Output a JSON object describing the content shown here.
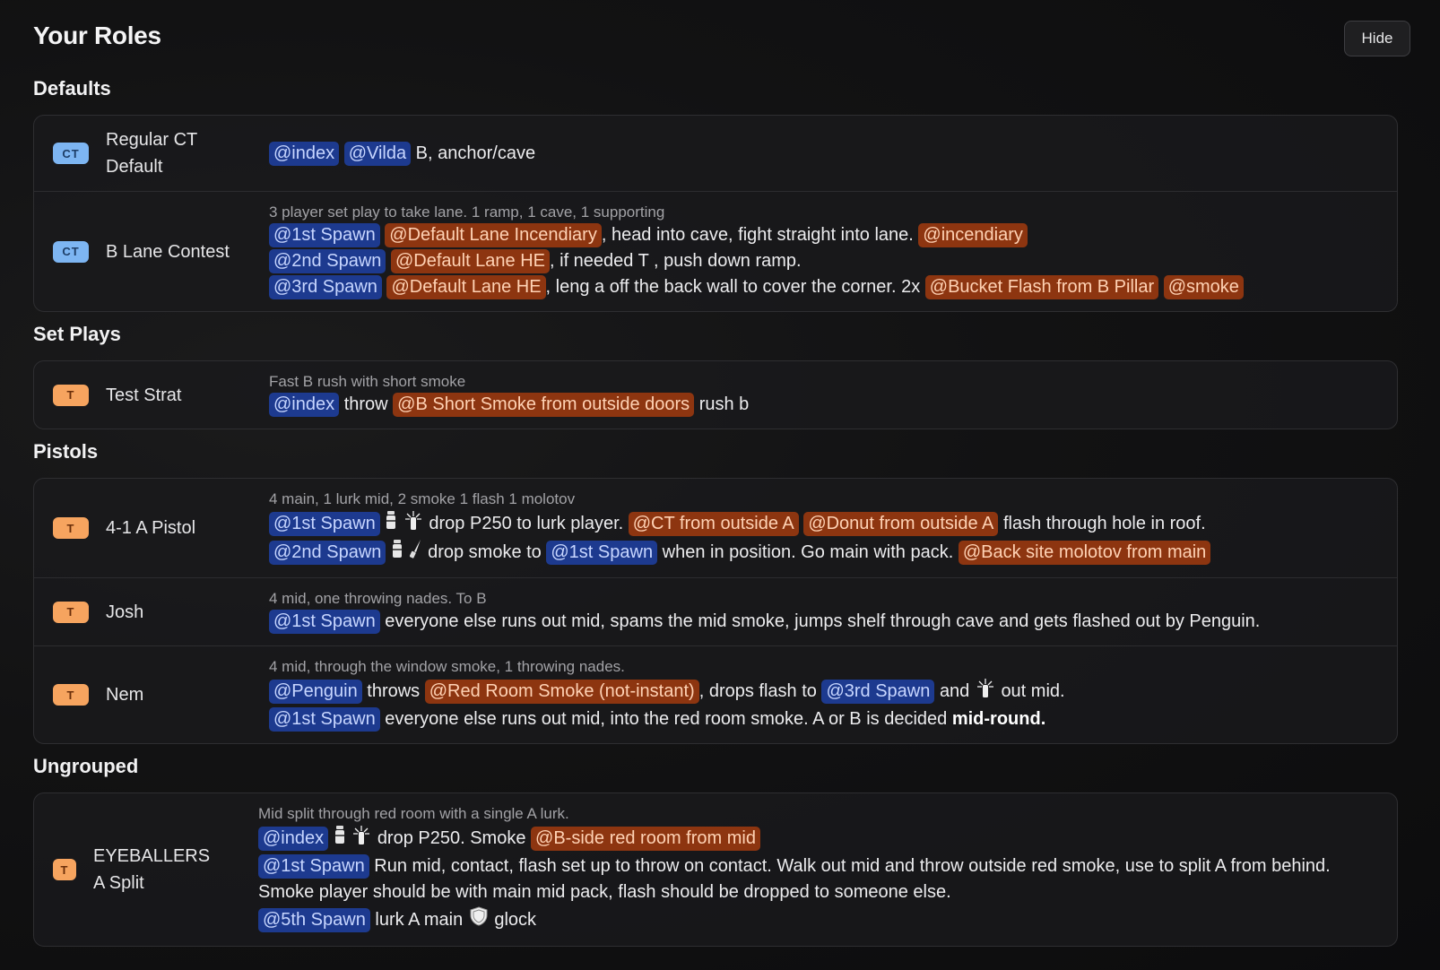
{
  "page": {
    "title": "Your Roles",
    "hide_label": "Hide"
  },
  "groups": [
    {
      "title": "Defaults",
      "rows": [
        {
          "side": "CT",
          "name": "Regular CT Default",
          "desc": "",
          "lines": [
            [
              {
                "t": "player",
                "v": "@index"
              },
              {
                "t": "player",
                "v": "@Vilda"
              },
              {
                "t": "text",
                "v": "B, anchor/cave"
              }
            ]
          ]
        },
        {
          "side": "CT",
          "name": "B Lane Contest",
          "desc": "3 player set play to take lane. 1 ramp, 1 cave, 1 supporting",
          "lines": [
            [
              {
                "t": "player",
                "v": "@1st Spawn"
              },
              {
                "t": "nade",
                "v": "@Default Lane Incendiary"
              },
              {
                "t": "text",
                "v": ", head into cave, fight straight into lane."
              },
              {
                "t": "nade",
                "v": "@incendiary"
              }
            ],
            [
              {
                "t": "player",
                "v": "@2nd Spawn"
              },
              {
                "t": "nade",
                "v": "@Default Lane HE"
              },
              {
                "t": "text",
                "v": ", if needed T , push down ramp."
              }
            ],
            [
              {
                "t": "player",
                "v": "@3rd Spawn"
              },
              {
                "t": "nade",
                "v": "@Default Lane HE"
              },
              {
                "t": "text",
                "v": ", leng a off the back wall to cover the corner. 2x"
              },
              {
                "t": "nade",
                "v": "@Bucket Flash from B Pillar"
              },
              {
                "t": "nade",
                "v": "@smoke"
              }
            ]
          ]
        }
      ]
    },
    {
      "title": "Set Plays",
      "rows": [
        {
          "side": "T",
          "name": "Test Strat",
          "desc": "Fast B rush with short smoke",
          "lines": [
            [
              {
                "t": "player",
                "v": "@index"
              },
              {
                "t": "text",
                "v": "throw"
              },
              {
                "t": "nade",
                "v": "@B Short Smoke from outside doors"
              },
              {
                "t": "text",
                "v": "rush b"
              }
            ]
          ]
        }
      ]
    },
    {
      "title": "Pistols",
      "rows": [
        {
          "side": "T",
          "name": "4-1 A Pistol",
          "desc": "4 main, 1 lurk mid, 2 smoke 1 flash 1 molotov",
          "lines": [
            [
              {
                "t": "player",
                "v": "@1st Spawn"
              },
              {
                "t": "icon",
                "v": "smoke-icon"
              },
              {
                "t": "icon",
                "v": "flash-icon"
              },
              {
                "t": "text",
                "v": "drop P250 to lurk player."
              },
              {
                "t": "nade",
                "v": "@CT from outside A"
              },
              {
                "t": "nade",
                "v": "@Donut from outside A"
              },
              {
                "t": "text",
                "v": "flash through hole in roof."
              }
            ],
            [
              {
                "t": "player",
                "v": "@2nd Spawn"
              },
              {
                "t": "icon",
                "v": "smoke-icon"
              },
              {
                "t": "icon",
                "v": "knife-icon"
              },
              {
                "t": "text",
                "v": "drop smoke to"
              },
              {
                "t": "player",
                "v": "@1st Spawn"
              },
              {
                "t": "text",
                "v": "when in position. Go main with pack."
              },
              {
                "t": "nade",
                "v": "@Back site molotov from main"
              }
            ]
          ]
        },
        {
          "side": "T",
          "name": "Josh",
          "desc": "4 mid, one throwing nades. To B",
          "lines": [
            [
              {
                "t": "player",
                "v": "@1st Spawn"
              },
              {
                "t": "text",
                "v": "everyone else runs out mid, spams the mid smoke, jumps shelf through cave and gets flashed out by Penguin."
              }
            ]
          ]
        },
        {
          "side": "T",
          "name": "Nem",
          "desc": "4 mid, through the window smoke, 1 throwing nades.",
          "lines": [
            [
              {
                "t": "player",
                "v": "@Penguin"
              },
              {
                "t": "text",
                "v": "throws"
              },
              {
                "t": "nade",
                "v": "@Red Room Smoke (not-instant)"
              },
              {
                "t": "text",
                "v": ", drops flash to"
              },
              {
                "t": "player",
                "v": "@3rd Spawn"
              },
              {
                "t": "text",
                "v": "and"
              },
              {
                "t": "icon",
                "v": "flash-icon"
              },
              {
                "t": "text",
                "v": "out mid."
              }
            ],
            [
              {
                "t": "player",
                "v": "@1st Spawn"
              },
              {
                "t": "text",
                "v": "everyone else runs out mid, into the red room smoke. A or B is decided"
              },
              {
                "t": "bold",
                "v": "mid-round."
              }
            ]
          ]
        }
      ]
    },
    {
      "title": "Ungrouped",
      "rows": [
        {
          "side": "T",
          "name": "EYEBALLERS A Split",
          "desc": "Mid split through red room with a single A lurk.",
          "narrow": true,
          "lines": [
            [
              {
                "t": "player",
                "v": "@index"
              },
              {
                "t": "icon",
                "v": "smoke-icon"
              },
              {
                "t": "icon",
                "v": "flash-icon"
              },
              {
                "t": "text",
                "v": "drop P250. Smoke"
              },
              {
                "t": "nade",
                "v": "@B-side red room from mid"
              }
            ],
            [
              {
                "t": "player",
                "v": "@1st Spawn"
              },
              {
                "t": "text",
                "v": "Run mid, contact, flash set up to throw on contact. Walk out mid and throw outside red smoke, use to split A from behind. Smoke player should be with main mid pack, flash should be dropped to someone else."
              }
            ],
            [
              {
                "t": "player",
                "v": "@5th Spawn"
              },
              {
                "t": "text",
                "v": "lurk A main"
              },
              {
                "t": "icon",
                "v": "kevlar-icon"
              },
              {
                "t": "text",
                "v": "glock"
              }
            ]
          ]
        }
      ]
    }
  ]
}
